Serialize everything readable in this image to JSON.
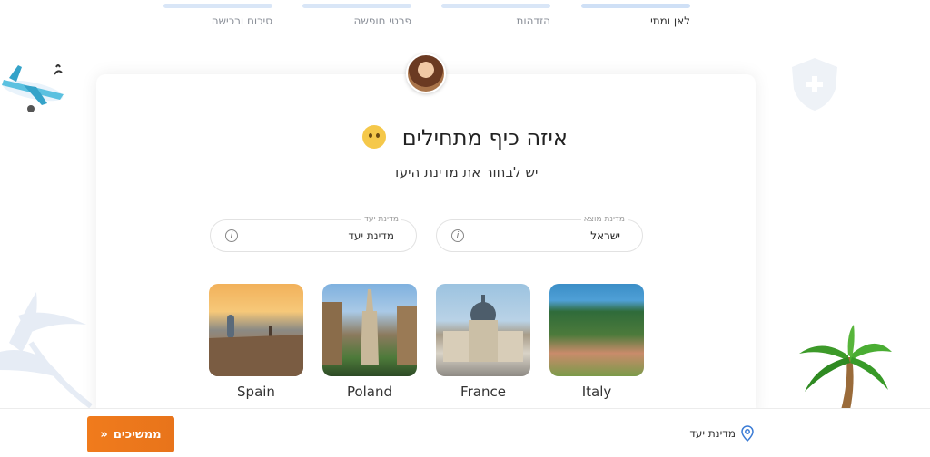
{
  "steps": [
    {
      "label": "לאן ומתי"
    },
    {
      "label": "הזדהות"
    },
    {
      "label": "פרטי חופשה"
    },
    {
      "label": "סיכום ורכישה"
    }
  ],
  "main": {
    "title": "איזה כיף מתחילים",
    "subtitle": "יש לבחור את מדינת היעד"
  },
  "fields": {
    "origin": {
      "label": "מדינת מוצא",
      "value": "ישראל"
    },
    "destination": {
      "label": "מדינת יעד",
      "value": "מדינת יעד"
    }
  },
  "destinations": [
    {
      "name": "Italy"
    },
    {
      "name": "France"
    },
    {
      "name": "Poland"
    },
    {
      "name": "Spain"
    }
  ],
  "bottom": {
    "continue_label": "ממשיכים",
    "destination_label": "מדינת יעד"
  },
  "colors": {
    "accent": "#f07b1c",
    "step_bar": "#d9e6f7",
    "pin_blue": "#3a7bd5"
  }
}
